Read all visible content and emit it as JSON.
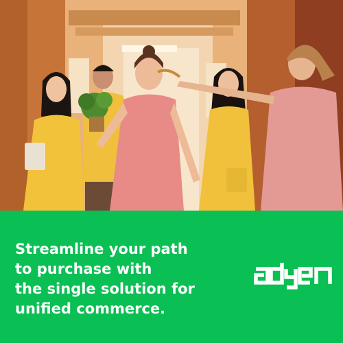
{
  "headline": {
    "lines": [
      "Streamline your path",
      "to purchase with",
      "the single solution for",
      "unified commerce."
    ]
  },
  "brand": {
    "name": "adyen",
    "color": "#0abf53",
    "text_color": "#ffffff"
  },
  "photo": {
    "icon": "photo-of-people-in-hallway"
  }
}
